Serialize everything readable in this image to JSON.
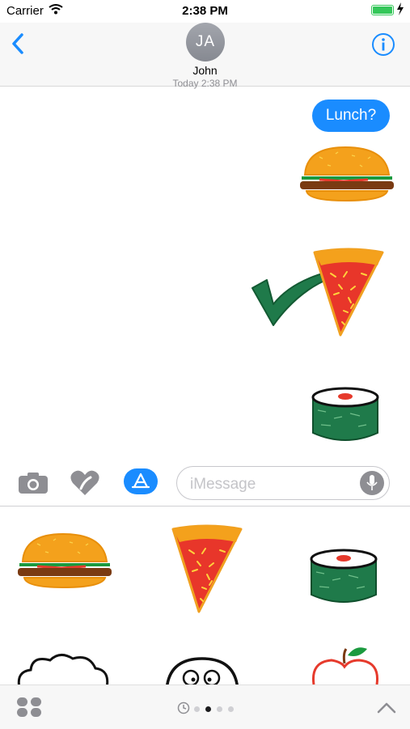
{
  "status_bar": {
    "carrier": "Carrier",
    "time": "2:38 PM"
  },
  "header": {
    "initials": "JA",
    "contact_name": "John",
    "timestamp": "Today 2:38 PM"
  },
  "conversation": {
    "messages": [
      {
        "type": "text",
        "text": "Lunch?"
      },
      {
        "type": "sticker",
        "sticker": "burger"
      },
      {
        "type": "sticker",
        "sticker": "check-mark"
      },
      {
        "type": "sticker",
        "sticker": "pizza-slice"
      },
      {
        "type": "sticker",
        "sticker": "sushi-roll"
      }
    ]
  },
  "compose": {
    "placeholder": "iMessage"
  },
  "sticker_drawer": {
    "row1": [
      "burger",
      "pizza-slice",
      "sushi-roll"
    ],
    "row2_partial": [
      "broccoli",
      "face",
      "apple"
    ]
  },
  "app_tray": {
    "page_count": 4,
    "active_page": 2
  },
  "colors": {
    "accent": "#1a8cff",
    "battery": "#34c759"
  }
}
